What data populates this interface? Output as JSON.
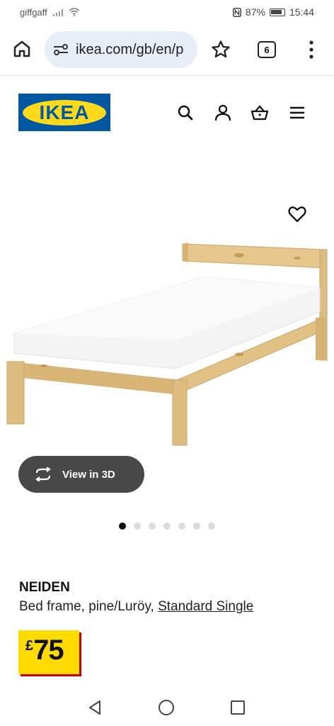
{
  "status": {
    "carrier": "giffgaff",
    "battery": "87%",
    "time": "15:44"
  },
  "browser": {
    "url": "ikea.com/gb/en/p",
    "tab_count": "6"
  },
  "site": {
    "logo_text": "IKEA"
  },
  "product": {
    "name": "NEIDEN",
    "description": "Bed frame, pine/Luröy, ",
    "size_link": "Standard Single",
    "price_currency": "£",
    "price_amount": "75",
    "view3d_label": "View in 3D",
    "gallery_count": 7,
    "gallery_active": 0
  },
  "colors": {
    "ikea_blue": "#0058a3",
    "ikea_yellow": "#ffda1a",
    "price_red": "#cc0008"
  }
}
